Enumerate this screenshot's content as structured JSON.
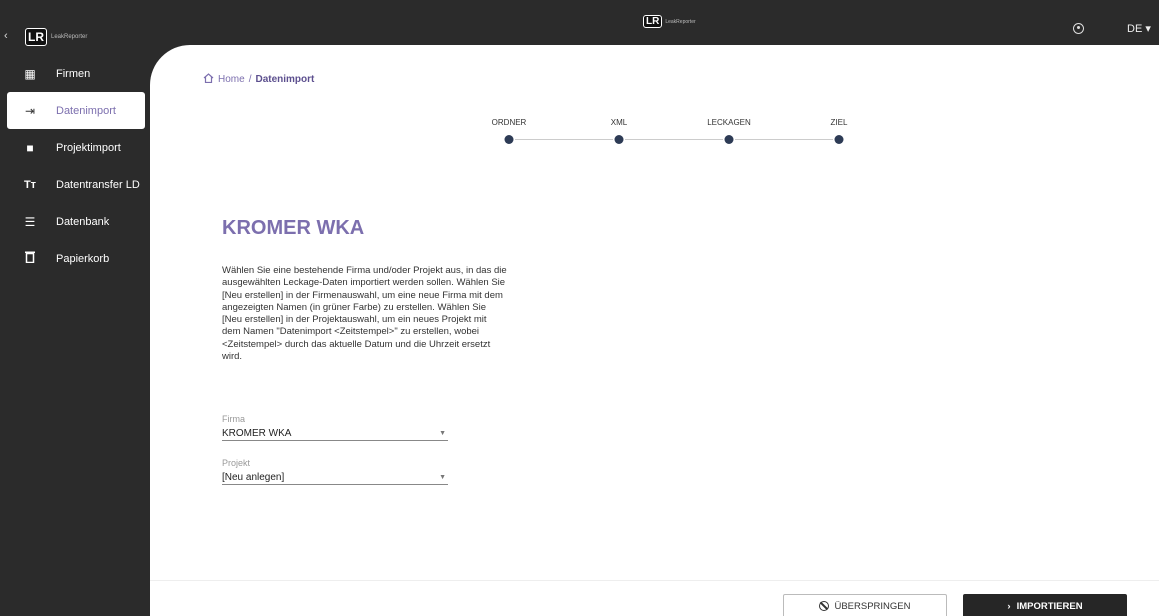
{
  "header": {
    "logo_mark": "LR",
    "logo_text": "LeakReporter",
    "language": "DE ▾",
    "collapse": "‹"
  },
  "sidebar": {
    "items": [
      {
        "label": "Firmen",
        "icon": "building-icon",
        "glyph": "▦"
      },
      {
        "label": "Datenimport",
        "icon": "import-icon",
        "glyph": "⇥"
      },
      {
        "label": "Projektimport",
        "icon": "briefcase-icon",
        "glyph": "■"
      },
      {
        "label": "Datentransfer LD",
        "icon": "text-size-icon",
        "glyph": "Tт"
      },
      {
        "label": "Datenbank",
        "icon": "list-icon",
        "glyph": "☰"
      },
      {
        "label": "Papierkorb",
        "icon": "trash-icon",
        "glyph": "🗑"
      }
    ],
    "active_index": 1
  },
  "breadcrumb": {
    "home": "Home",
    "separator": "/",
    "current": "Datenimport"
  },
  "stepper": {
    "steps": [
      "ORDNER",
      "XML",
      "LECKAGEN",
      "ZIEL"
    ]
  },
  "main": {
    "title": "KROMER WKA",
    "description": "Wählen Sie eine bestehende Firma und/oder Projekt aus, in das die ausgewählten Leckage-Daten importiert werden sollen. Wählen Sie [Neu erstellen] in der Firmenauswahl, um eine neue Firma mit dem angezeigten Namen (in grüner Farbe) zu erstellen. Wählen Sie [Neu erstellen] in der Projektauswahl, um ein neues Projekt mit dem Namen \"Datenimport <Zeitstempel>\" zu erstellen, wobei <Zeitstempel> durch das aktuelle Datum und die Uhrzeit ersetzt wird.",
    "firma": {
      "label": "Firma",
      "value": "KROMER WKA"
    },
    "projekt": {
      "label": "Projekt",
      "value": "[Neu anlegen]"
    }
  },
  "footer": {
    "skip_label": "ÜBERSPRINGEN",
    "import_label": "IMPORTIEREN",
    "import_glyph": "›"
  },
  "colors": {
    "accent": "#7c6fae",
    "sidebar_bg": "#2b2b2b",
    "step_dot": "#2d3b55",
    "primary_button": "#262626"
  }
}
